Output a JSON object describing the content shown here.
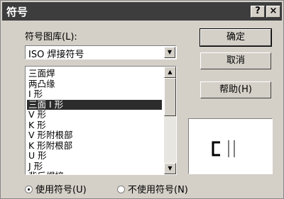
{
  "window": {
    "title": "符号",
    "help_glyph": "?",
    "close_glyph": "×"
  },
  "library": {
    "label": "符号图库(L):",
    "selected": "ISO 焊接符号"
  },
  "symbols": {
    "items": [
      "三面焊",
      "两凸缘",
      "I 形",
      "三面 I 形",
      "V 形",
      "K 形",
      "V 形附根部",
      "K 形附根部",
      "U 形",
      "J 形",
      "背后焊接"
    ],
    "selected_index": 3
  },
  "buttons": {
    "ok": "确定",
    "cancel": "取消",
    "help": "帮助(H)"
  },
  "options": {
    "use_symbol": "使用符号(U)",
    "no_symbol": "不使用符号(N)",
    "selected": "use_symbol"
  },
  "preview": {
    "symbol_icon": "weld-symbol-preview"
  }
}
